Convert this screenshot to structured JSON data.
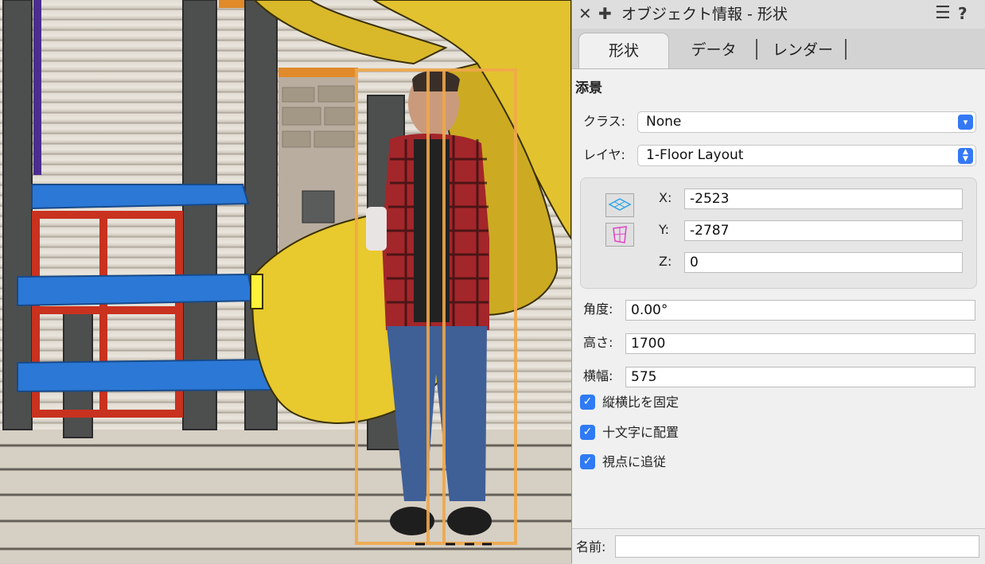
{
  "panel": {
    "title": "オブジェクト情報 - 形状",
    "close_icon": "close-icon",
    "add_icon": "plus-icon",
    "menu_icon": "hamburger-menu-icon",
    "help_label": "?",
    "tabs": [
      {
        "label": "形状",
        "active": true
      },
      {
        "label": "データ",
        "active": false
      },
      {
        "label": "レンダー",
        "active": false
      }
    ],
    "section_title": "添景",
    "class_label": "クラス:",
    "class_value": "None",
    "layer_label": "レイヤ:",
    "layer_value": "1-Floor Layout",
    "x_label": "X:",
    "x_value": "-2523",
    "y_label": "Y:",
    "y_value": "-2787",
    "z_label": "Z:",
    "z_value": "0",
    "angle_label": "角度:",
    "angle_value": "0.00°",
    "height_label": "高さ:",
    "height_value": "1700",
    "width_label": "横幅:",
    "width_value": "575",
    "checkboxes": [
      {
        "label": "縦横比を固定",
        "checked": true
      },
      {
        "label": "十文字に配置",
        "checked": true
      },
      {
        "label": "視点に追従",
        "checked": true
      }
    ],
    "name_label": "名前:",
    "name_value": ""
  },
  "colors": {
    "accent": "#2f7bf5",
    "selection_box": "#f0a84a",
    "slide": "#e6c32a"
  }
}
